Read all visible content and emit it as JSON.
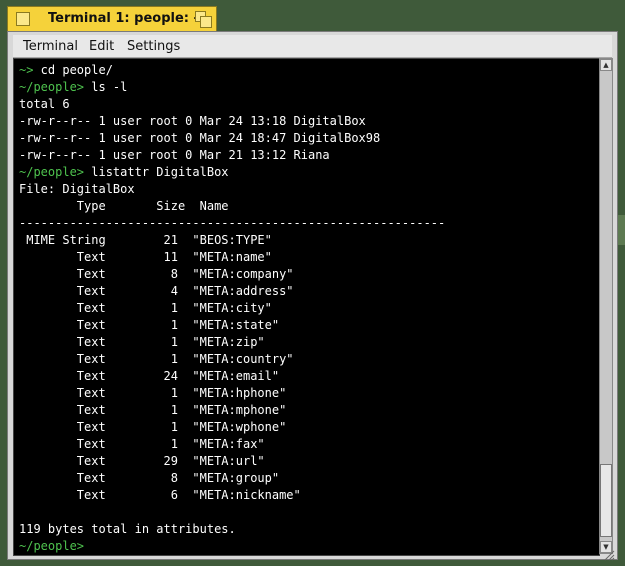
{
  "window": {
    "title": "Terminal 1: people: --",
    "menu": [
      "Terminal",
      "Edit",
      "Settings"
    ]
  },
  "terminal": {
    "lines": [
      [
        {
          "t": "~>",
          "c": "green"
        },
        {
          "t": " cd people/",
          "c": "white"
        }
      ],
      [
        {
          "t": "~/people>",
          "c": "green"
        },
        {
          "t": " ls -l",
          "c": "white"
        }
      ],
      [
        {
          "t": "total 6",
          "c": "white"
        }
      ],
      [
        {
          "t": "-rw-r--r-- 1 user root 0 Mar 24 13:18 DigitalBox",
          "c": "white"
        }
      ],
      [
        {
          "t": "-rw-r--r-- 1 user root 0 Mar 24 18:47 DigitalBox98",
          "c": "white"
        }
      ],
      [
        {
          "t": "-rw-r--r-- 1 user root 0 Mar 21 13:12 Riana",
          "c": "white"
        }
      ],
      [
        {
          "t": "~/people>",
          "c": "green"
        },
        {
          "t": " listattr DigitalBox",
          "c": "white"
        }
      ],
      [
        {
          "t": "File: DigitalBox",
          "c": "white"
        }
      ],
      [
        {
          "t": "        Type       Size  Name",
          "c": "white"
        }
      ],
      [
        {
          "t": "-----------------------------------------------------------",
          "c": "white"
        }
      ],
      [
        {
          "t": " MIME String        21  \"BEOS:TYPE\"",
          "c": "white"
        }
      ],
      [
        {
          "t": "        Text        11  \"META:name\"",
          "c": "white"
        }
      ],
      [
        {
          "t": "        Text         8  \"META:company\"",
          "c": "white"
        }
      ],
      [
        {
          "t": "        Text         4  \"META:address\"",
          "c": "white"
        }
      ],
      [
        {
          "t": "        Text         1  \"META:city\"",
          "c": "white"
        }
      ],
      [
        {
          "t": "        Text         1  \"META:state\"",
          "c": "white"
        }
      ],
      [
        {
          "t": "        Text         1  \"META:zip\"",
          "c": "white"
        }
      ],
      [
        {
          "t": "        Text         1  \"META:country\"",
          "c": "white"
        }
      ],
      [
        {
          "t": "        Text        24  \"META:email\"",
          "c": "white"
        }
      ],
      [
        {
          "t": "        Text         1  \"META:hphone\"",
          "c": "white"
        }
      ],
      [
        {
          "t": "        Text         1  \"META:mphone\"",
          "c": "white"
        }
      ],
      [
        {
          "t": "        Text         1  \"META:wphone\"",
          "c": "white"
        }
      ],
      [
        {
          "t": "        Text         1  \"META:fax\"",
          "c": "white"
        }
      ],
      [
        {
          "t": "        Text        29  \"META:url\"",
          "c": "white"
        }
      ],
      [
        {
          "t": "        Text         8  \"META:group\"",
          "c": "white"
        }
      ],
      [
        {
          "t": "        Text         6  \"META:nickname\"",
          "c": "white"
        }
      ],
      [
        {
          "t": "",
          "c": "white"
        }
      ],
      [
        {
          "t": "119 bytes total in attributes.",
          "c": "white"
        }
      ],
      [
        {
          "t": "~/people>",
          "c": "green"
        }
      ]
    ]
  },
  "icons": {
    "close": "close-box-icon",
    "zoom": "zoom-icon",
    "scroll_up": "arrow-up-icon",
    "scroll_down": "arrow-down-icon",
    "resize": "resize-grip-icon"
  },
  "colors": {
    "tab": "#f5d23a",
    "prompt": "#4ec24e",
    "text": "#ffffff",
    "terminal_bg": "#000000"
  }
}
